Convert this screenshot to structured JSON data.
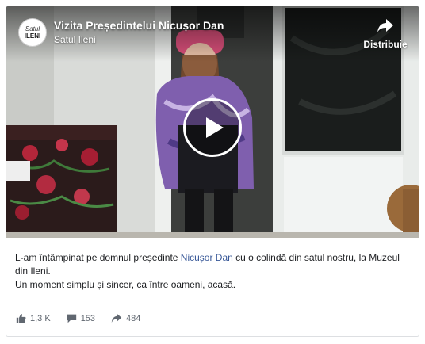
{
  "video": {
    "title": "Vizita Președintelui Nicușor Dan",
    "page_name": "Satul Ileni",
    "avatar_line1": "Satul",
    "avatar_line2": "ILENI",
    "share_label": "Distribuie"
  },
  "post": {
    "text_before_link": "L-am întâmpinat pe domnul președinte ",
    "link_text": "Nicușor Dan",
    "text_after_link": " cu o colindă din satul nostru, la Muzeul din Ileni.",
    "line2": "Un moment simplu și sincer, ca între oameni, acasă."
  },
  "stats": {
    "likes": "1,3 K",
    "comments": "153",
    "shares": "484"
  },
  "colors": {
    "link": "#385898",
    "muted": "#606770",
    "border": "#dddfe2"
  },
  "icons": [
    "share-icon",
    "play-icon",
    "like-icon",
    "comment-icon",
    "share-arrow-icon"
  ]
}
